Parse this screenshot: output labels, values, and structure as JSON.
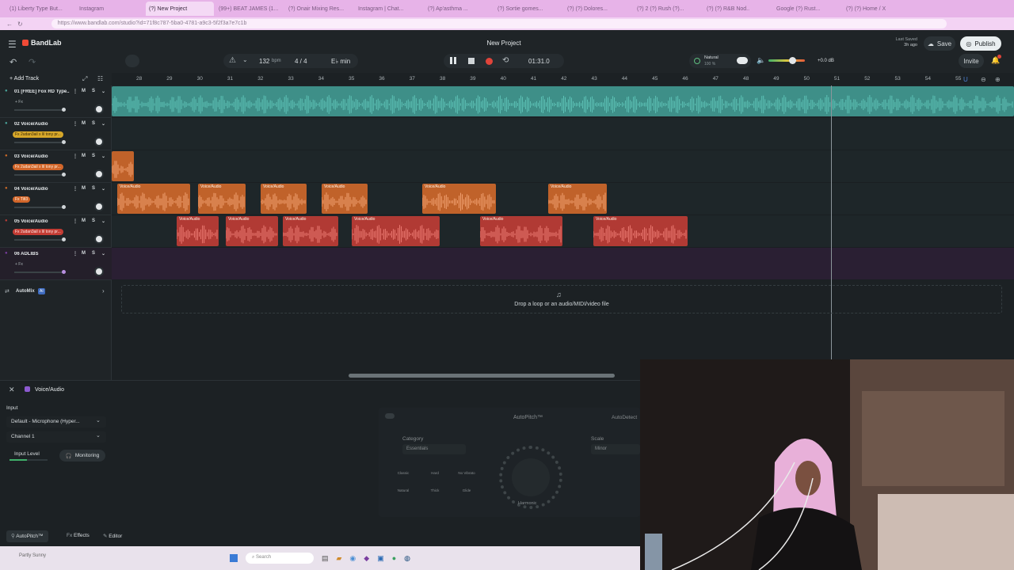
{
  "browser": {
    "tabs": [
      "(1) Liberty Type But...",
      "Instagram",
      "(?) New Project",
      "(99+) BEAT JAMES (1...",
      "(?) Onair Mixing Res...",
      "Instagram | Chat...",
      "(?) Ap'asthma ...",
      "(?) Sortie gomes...",
      "(?) (?) Dolores...",
      "(?) 2 (?) Rush (?)...",
      "(?) (?) R&B Nod..",
      "Google (?) Rust...",
      "(?) (?) Home / X"
    ],
    "url": "https://www.bandlab.com/studio?id=71f8c787-5ba0-4781-a9c3-5f2f3a7e7c1b"
  },
  "app": {
    "brand": "BandLab",
    "project_title": "New Project",
    "last_saved_label": "Last Saved",
    "last_saved_value": "3h ago",
    "save_label": "Save",
    "publish_label": "Publish",
    "invite_label": "Invite",
    "bpm_value": "132",
    "bpm_unit": "bpm",
    "time_sig": "4 / 4",
    "key": "E♭ min",
    "time": "01:31.0",
    "tuner_label": "Natural",
    "tuner_value": "100 %",
    "master_db": "+0.0 dB",
    "add_track_label": "Add Track"
  },
  "ruler": [
    "28",
    "29",
    "30",
    "31",
    "32",
    "33",
    "34",
    "35",
    "36",
    "37",
    "38",
    "39",
    "40",
    "41",
    "42",
    "43",
    "44",
    "45",
    "46",
    "47",
    "48",
    "49",
    "50",
    "51",
    "52",
    "53",
    "54",
    "55"
  ],
  "tracks": [
    {
      "name": "01 [FREE] Fox RD Type...",
      "fx": "+ Fx",
      "fxStyle": "none",
      "color": "#4aa39a"
    },
    {
      "name": "02 Voice/Audio",
      "fx": "Fx 2udan3ail x lil tony pr...",
      "fxStyle": "yellow",
      "color": "#4aa39a"
    },
    {
      "name": "03 Voice/Audio",
      "fx": "Fx 2udan3ail x lil tony pr...",
      "fxStyle": "orange",
      "color": "#cc6a28"
    },
    {
      "name": "04 Voice/Audio",
      "fx": "Fx Tilt3",
      "fxStyle": "orange",
      "color": "#cc6a28"
    },
    {
      "name": "05 Voice/Audio",
      "fx": "Fx 2udan3ail x lil tony pr...",
      "fxStyle": "red",
      "color": "#b33c36"
    },
    {
      "name": "06 ADLIBS",
      "fx": "+ Fx",
      "fxStyle": "none",
      "color": "#7a3ea0"
    }
  ],
  "track_buttons": {
    "mute": "M",
    "solo": "S"
  },
  "clip_label": "Voice/Audio",
  "automix": {
    "label": "AutoMix",
    "badge": "AI"
  },
  "drop_hint": "Drop a loop or an audio/MIDI/video file",
  "panel": {
    "title": "Voice/Audio",
    "input_label": "Input",
    "input_device": "Default - Microphone (Hyper...",
    "channel": "Channel 1",
    "input_level_label": "Input Level",
    "monitoring_label": "Monitoring",
    "autopitch_title": "AutoPitch™",
    "autodetect_label": "AutoDetect",
    "category_label": "Category",
    "category_value": "Essentials",
    "scale_label": "Scale",
    "scale_value": "Minor",
    "presets": [
      "Classic",
      "Hard",
      "No Vibrato",
      "Natural",
      "Thick",
      "Glide"
    ],
    "knob_label": "Harmonic",
    "bottom_tabs": [
      "AutoPitch™",
      "Effects",
      "Editor"
    ]
  },
  "taskbar": {
    "search": "Search",
    "weather": "Partly Sunny"
  }
}
